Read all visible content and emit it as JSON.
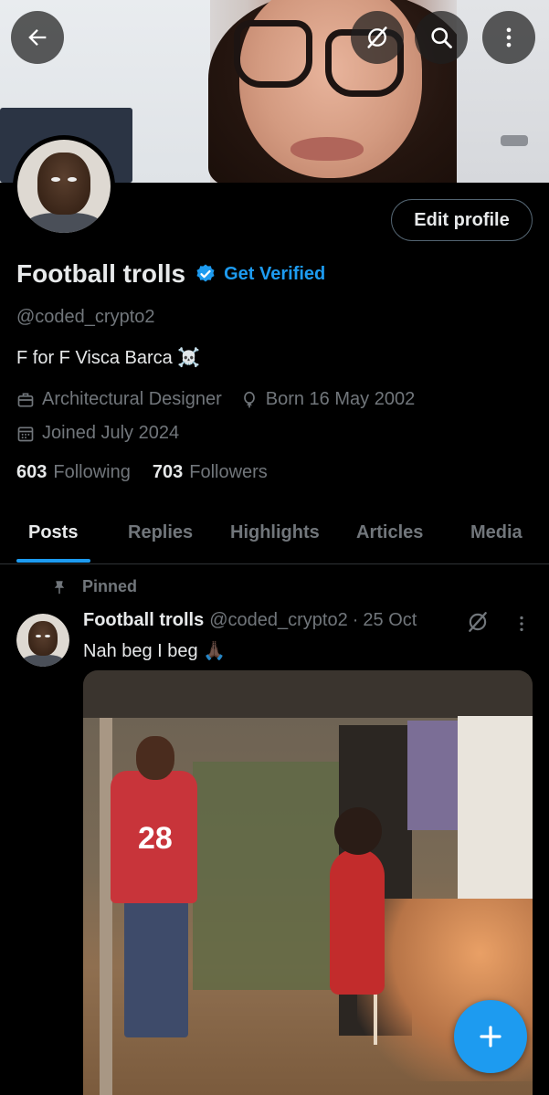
{
  "header": {
    "back_icon": "arrow-left-icon",
    "grok_icon": "grok-slash-icon",
    "search_icon": "search-icon",
    "more_icon": "more-vertical-icon"
  },
  "profile": {
    "edit_label": "Edit profile",
    "name": "Football trolls",
    "get_verified": "Get Verified",
    "handle": "@coded_crypto2",
    "bio": "F for F Visca Barca ☠️",
    "profession": "Architectural Designer",
    "birthday": "Born 16 May 2002",
    "joined": "Joined July 2024",
    "following_count": "603",
    "following_label": "Following",
    "followers_count": "703",
    "followers_label": "Followers"
  },
  "tabs": [
    {
      "label": "Posts",
      "active": true
    },
    {
      "label": "Replies",
      "active": false
    },
    {
      "label": "Highlights",
      "active": false
    },
    {
      "label": "Articles",
      "active": false
    },
    {
      "label": "Media",
      "active": false
    }
  ],
  "post": {
    "pinned_label": "Pinned",
    "author_name": "Football trolls",
    "author_handle": "@coded_crypto2",
    "separator": "·",
    "date": "25 Oct",
    "text": "Nah beg I beg 🙏🏿",
    "media_jersey_number": "28"
  },
  "colors": {
    "accent": "#1d9bf0",
    "background": "#000000",
    "text_primary": "#e7e9ea",
    "text_secondary": "#71767b"
  }
}
